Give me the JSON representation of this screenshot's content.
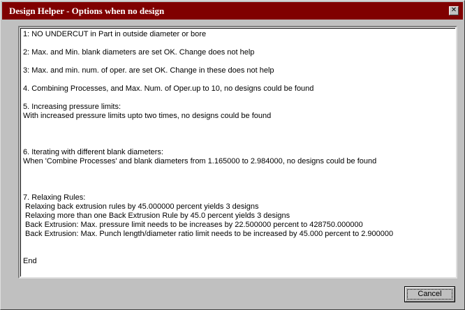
{
  "window": {
    "title": "Design Helper - Options when no design",
    "close_symbol": "✕"
  },
  "content": {
    "lines": [
      "1: NO UNDERCUT in Part in outside diameter or bore",
      "2: Max. and Min. blank diameters are set OK. Change does not help",
      "3: Max. and min. num. of oper. are set OK. Change in these does not help",
      "4. Combining Processes, and Max. Num. of Oper.up to 10, no designs could be found",
      "5. Increasing pressure limits:",
      "With increased pressure limits upto two times, no designs could be found",
      "6. Iterating with different blank diameters:",
      "When 'Combine Processes' and blank diameters from 1.165000 to 2.984000, no designs could be found",
      "7. Relaxing Rules:",
      " Relaxing back extrusion rules by 45.000000 percent yields 3 designs",
      " Relaxing more than one Back Extrusion Rule by 45.0 percent yields 3 designs",
      " Back Extrusion: Max. pressure limit needs to be increases by 22.500000 percent to 428750.000000",
      " Back Extrusion: Max. Punch length/diameter ratio limit needs to be increased by 45.000 percent to 2.900000",
      "End"
    ]
  },
  "buttons": {
    "cancel_label": "Cancel"
  }
}
